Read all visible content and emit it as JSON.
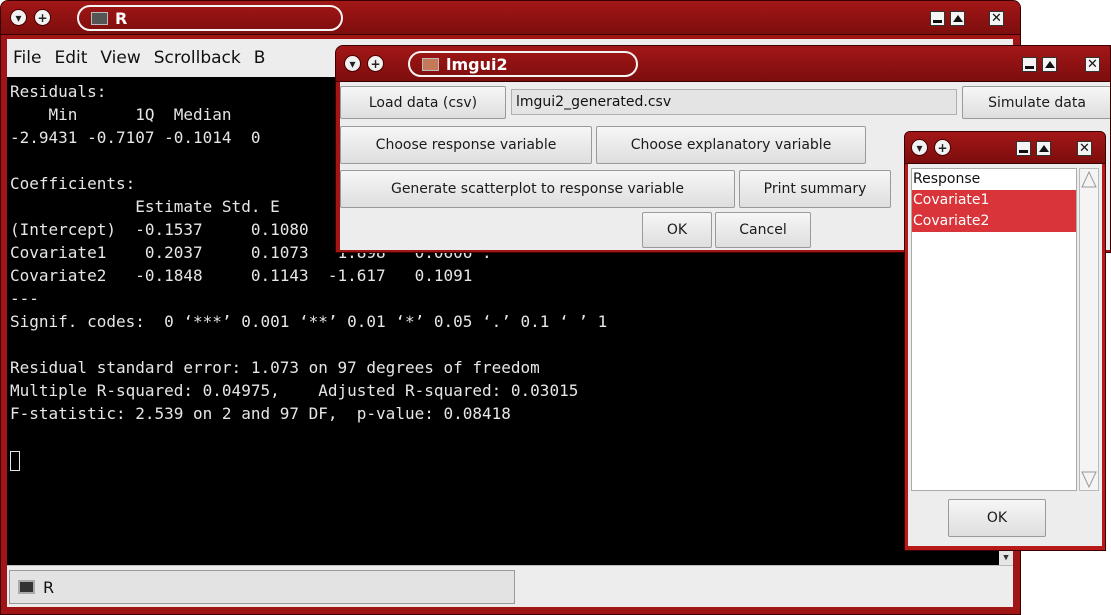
{
  "r_window": {
    "title": "R",
    "menu": [
      "File",
      "Edit",
      "View",
      "Scrollback",
      "B"
    ],
    "console_lines": [
      "Residuals:",
      "    Min      1Q  Median",
      "-2.9431 -0.7107 -0.1014  0",
      "",
      "Coefficients:",
      "             Estimate Std. E",
      "(Intercept)  -0.1537     0.1080   1.424   0.1578",
      "Covariate1    0.2037     0.1073   1.898   0.0606 .",
      "Covariate2   -0.1848     0.1143  -1.617   0.1091",
      "---",
      "Signif. codes:  0 ‘***’ 0.001 ‘**’ 0.01 ‘*’ 0.05 ‘.’ 0.1 ‘ ’ 1",
      "",
      "Residual standard error: 1.073 on 97 degrees of freedom",
      "Multiple R-squared: 0.04975,    Adjusted R-squared: 0.03015",
      "F-statistic: 2.539 on 2 and 97 DF,  p-value: 0.08418",
      ""
    ],
    "taskbar_label": "R"
  },
  "lmgui_window": {
    "title": "lmgui2",
    "load_button": "Load data (csv)",
    "file_field": "lmgui2_generated.csv",
    "simulate_button": "Simulate data",
    "response_button": "Choose response variable",
    "explanatory_button": "Choose explanatory variable",
    "scatterplot_button": "Generate scatterplot to response variable",
    "summary_button": "Print summary",
    "ok_button": "OK",
    "cancel_button": "Cancel"
  },
  "var_window": {
    "items": [
      "Response",
      "Covariate1",
      "Covariate2"
    ],
    "selected": [
      1,
      2
    ],
    "ok_button": "OK"
  },
  "colors": {
    "titlebar": "#a01616",
    "selection": "#d9343a",
    "console_bg": "#000000",
    "console_fg": "#e6e6e6"
  },
  "icons": [
    "menu-arrow-icon",
    "pin-plus-icon",
    "terminal-icon",
    "minimize-icon",
    "maximize-icon",
    "close-icon"
  ]
}
